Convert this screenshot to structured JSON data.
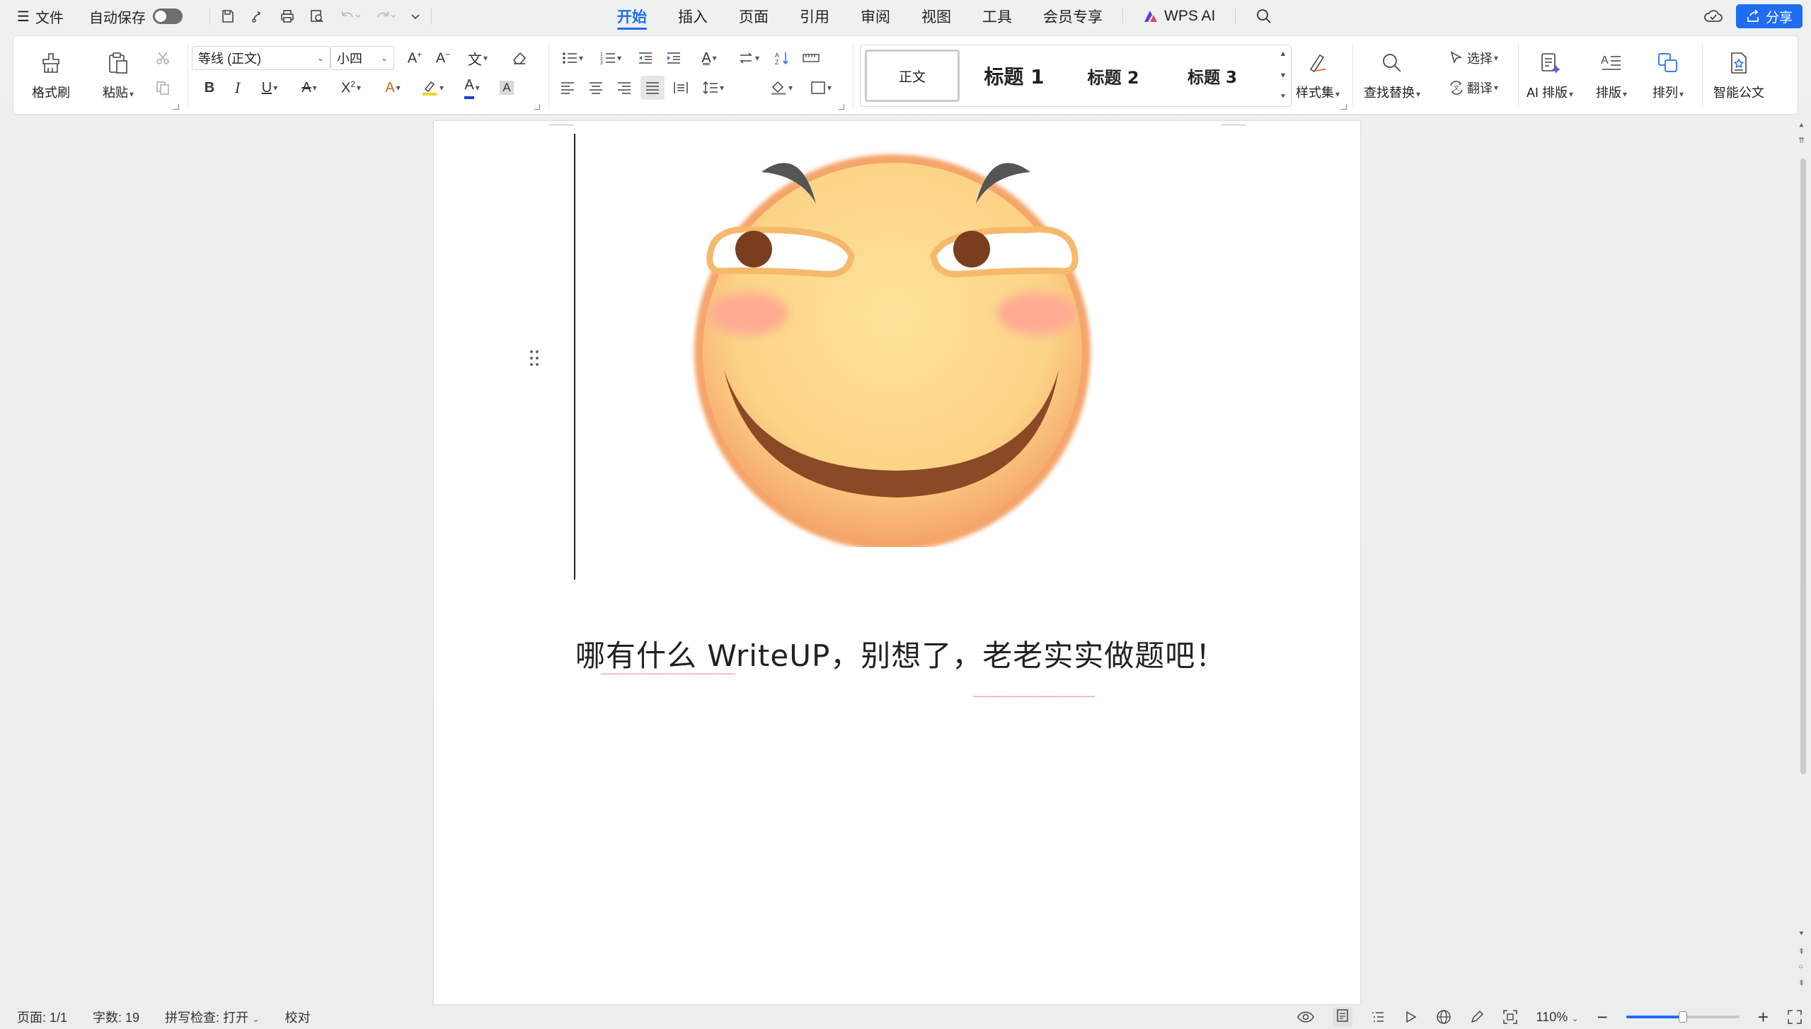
{
  "topbar": {
    "file_label": "文件",
    "autosave_label": "自动保存",
    "autosave_on": false,
    "tabs": [
      "开始",
      "插入",
      "页面",
      "引用",
      "审阅",
      "视图",
      "工具",
      "会员专享"
    ],
    "active_tab": "开始",
    "wps_ai_label": "WPS AI",
    "share_label": "分享"
  },
  "ribbon": {
    "format_painter_label": "格式刷",
    "paste_label": "粘贴",
    "font_name": "等线 (正文)",
    "font_size": "小四",
    "styles": {
      "normal": "正文",
      "heading1": "标题 1",
      "heading2": "标题 2",
      "heading3": "标题 3"
    },
    "style_set_label": "样式集",
    "find_replace_label": "查找替换",
    "select_label": "选择",
    "translate_label": "翻译",
    "ai_layout_label": "AI 排版",
    "layout_label": "排版",
    "arrange_label": "排列",
    "smart_doc_label": "智能公文",
    "font_color": "#1a3fd6",
    "highlight_color": "#f2d12a"
  },
  "document": {
    "text": "哪有什么 WriteUP，别想了，老老实实做题吧！"
  },
  "statusbar": {
    "page": "页面: 1/1",
    "word_count": "字数: 19",
    "spell_check": "拼写检查: 打开",
    "proofread": "校对",
    "zoom": "110%",
    "zoom_fraction": 0.5
  },
  "colors": {
    "accent": "#1f6cf5"
  }
}
